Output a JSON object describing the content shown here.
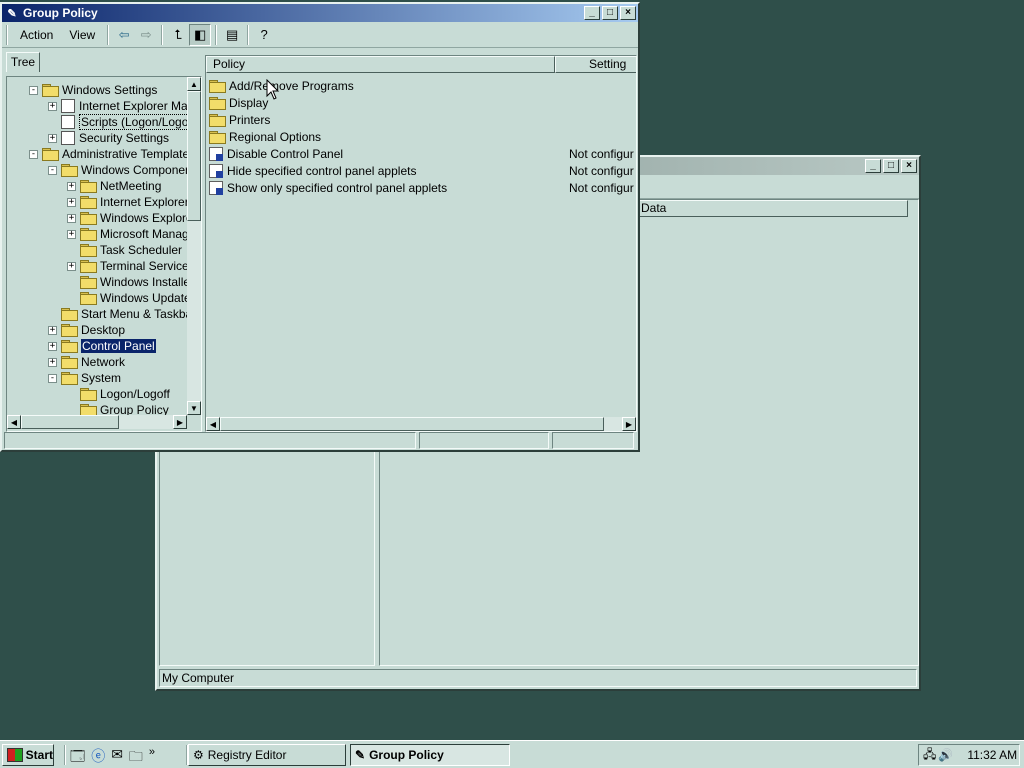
{
  "registry_window": {
    "title": "Registry Editor",
    "column_data": "Data",
    "status": "My Computer"
  },
  "gp_window": {
    "title": "Group Policy",
    "menu": [
      "Action",
      "View"
    ],
    "tree_tab": "Tree",
    "tree": [
      {
        "label": "Windows Settings",
        "expander": "-"
      },
      {
        "label": "Internet Explorer Main",
        "expander": "+"
      },
      {
        "label": "Scripts (Logon/Logoff)",
        "expander": ""
      },
      {
        "label": "Security Settings",
        "expander": "+"
      },
      {
        "label": "Administrative Templates",
        "expander": "-"
      },
      {
        "label": "Windows Components",
        "expander": "-"
      },
      {
        "label": "NetMeeting",
        "expander": "+"
      },
      {
        "label": "Internet Explorer",
        "expander": "+"
      },
      {
        "label": "Windows Explorer",
        "expander": "+"
      },
      {
        "label": "Microsoft Management",
        "expander": "+"
      },
      {
        "label": "Task Scheduler",
        "expander": ""
      },
      {
        "label": "Terminal Services",
        "expander": "+"
      },
      {
        "label": "Windows Installer",
        "expander": ""
      },
      {
        "label": "Windows Update",
        "expander": ""
      },
      {
        "label": "Start Menu & Taskbar",
        "expander": ""
      },
      {
        "label": "Desktop",
        "expander": "+"
      },
      {
        "label": "Control Panel",
        "expander": "+"
      },
      {
        "label": "Network",
        "expander": "+"
      },
      {
        "label": "System",
        "expander": "-"
      },
      {
        "label": "Logon/Logoff",
        "expander": ""
      },
      {
        "label": "Group Policy",
        "expander": ""
      }
    ],
    "columns": {
      "policy": "Policy",
      "setting": "Setting"
    },
    "rows": [
      {
        "name": "Add/Remove Programs",
        "setting": "",
        "kind": "folder"
      },
      {
        "name": "Display",
        "setting": "",
        "kind": "folder"
      },
      {
        "name": "Printers",
        "setting": "",
        "kind": "folder"
      },
      {
        "name": "Regional Options",
        "setting": "",
        "kind": "folder"
      },
      {
        "name": "Disable Control Panel",
        "setting": "Not configured",
        "kind": "policy"
      },
      {
        "name": "Hide specified control panel applets",
        "setting": "Not configured",
        "kind": "policy"
      },
      {
        "name": "Show only specified control panel applets",
        "setting": "Not configured",
        "kind": "policy"
      }
    ]
  },
  "taskbar": {
    "start": "Start",
    "tasks": [
      {
        "label": "Registry Editor",
        "active": false
      },
      {
        "label": "Group Policy",
        "active": true
      }
    ],
    "clock": "11:32 AM"
  }
}
